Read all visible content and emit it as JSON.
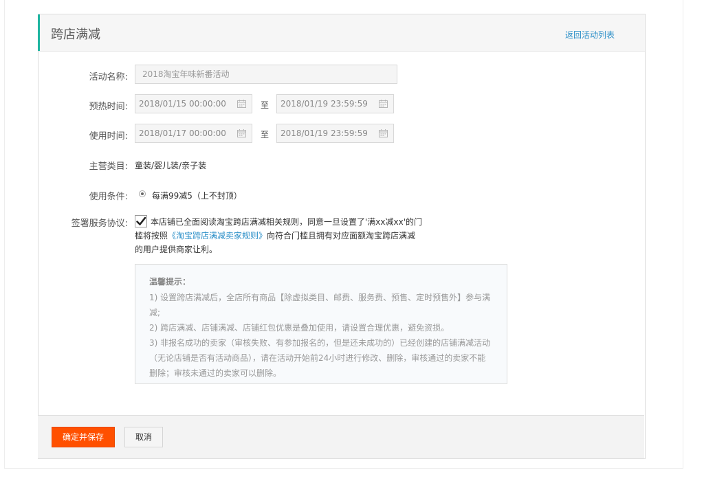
{
  "header": {
    "title": "跨店满减",
    "back_link": "返回活动列表"
  },
  "form": {
    "activity_name": {
      "label": "活动名称:",
      "value": "2018淘宝年味新番活动"
    },
    "preheat_time": {
      "label": "预热时间:",
      "start": "2018/01/15 00:00:00",
      "to": "至",
      "end": "2018/01/19 23:59:59"
    },
    "use_time": {
      "label": "使用时间:",
      "start": "2018/01/17 00:00:00",
      "to": "至",
      "end": "2018/01/19 23:59:59"
    },
    "category": {
      "label": "主营类目:",
      "value": "童装/婴儿装/亲子装"
    },
    "condition": {
      "label": "使用条件:",
      "option": "每满99减5（上不封顶）"
    },
    "agreement": {
      "label": "签署服务协议:",
      "checked": true,
      "text_part1": "本店铺已全面阅读淘宝跨店满减相关规则，同意一旦设置了'满xx减xx'的门槛将按照",
      "link": "《淘宝跨店满减卖家规则》",
      "text_part2": "向符合门槛且拥有对应面额淘宝跨店满减的用户提供商家让利。"
    }
  },
  "tips": {
    "title": "温馨提示：",
    "items": [
      "1) 设置跨店满减后，全店所有商品【除虚拟类目、邮费、服务费、预售、定时预售外】参与满减;",
      "2) 跨店满减、店铺满减、店铺红包优惠是叠加使用，请设置合理优惠，避免资损。",
      "3) 非报名成功的卖家（审核失败、有参加报名的，但是还未成功的）已经创建的店铺满减活动（无论店铺是否有活动商品），请在活动开始前24小时进行修改、删除，审核通过的卖家不能删除；审核未通过的卖家可以删除。"
    ]
  },
  "footer": {
    "confirm_label": "确定并保存",
    "cancel_label": "取消"
  },
  "colors": {
    "accent": "#1fb5a1",
    "primary_button": "#ff5000",
    "link": "#2b8fc8"
  },
  "icons": {
    "calendar": "calendar-icon",
    "checkmark": "checkmark-icon"
  }
}
